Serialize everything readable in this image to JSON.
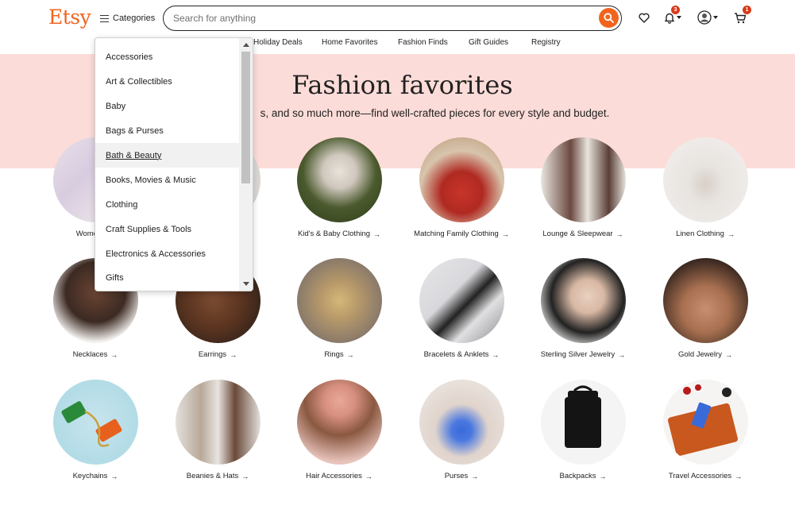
{
  "header": {
    "logo": "Etsy",
    "categories_label": "Categories",
    "search_placeholder": "Search for anything",
    "notifications_badge": "3",
    "cart_badge": "1"
  },
  "subnav": [
    "Holiday Deals",
    "Home Favorites",
    "Fashion Finds",
    "Gift Guides",
    "Registry"
  ],
  "banner": {
    "title": "Fashion favorites",
    "subtitle": "s, and so much more—find well-crafted pieces for every style and budget."
  },
  "dropdown": {
    "items": [
      "Accessories",
      "Art & Collectibles",
      "Baby",
      "Bags & Purses",
      "Bath & Beauty",
      "Books, Movies & Music",
      "Clothing",
      "Craft Supplies & Tools",
      "Electronics & Accessories",
      "Gifts"
    ],
    "active": "Bath & Beauty"
  },
  "grid": {
    "row1": [
      "Women's C",
      "",
      "Kid's & Baby Clothing",
      "Matching Family Clothing",
      "Lounge & Sleepwear",
      "Linen Clothing"
    ],
    "row2": [
      "Necklaces",
      "Earrings",
      "Rings",
      "Bracelets & Anklets",
      "Sterling Silver Jewelry",
      "Gold Jewelry"
    ],
    "row3": [
      "Keychains",
      "Beanies & Hats",
      "Hair Accessories",
      "Purses",
      "Backpacks",
      "Travel Accessories"
    ]
  },
  "colors": {
    "brand": "#f1641e",
    "banner": "#fcdcd8",
    "badge": "#d93a19"
  }
}
